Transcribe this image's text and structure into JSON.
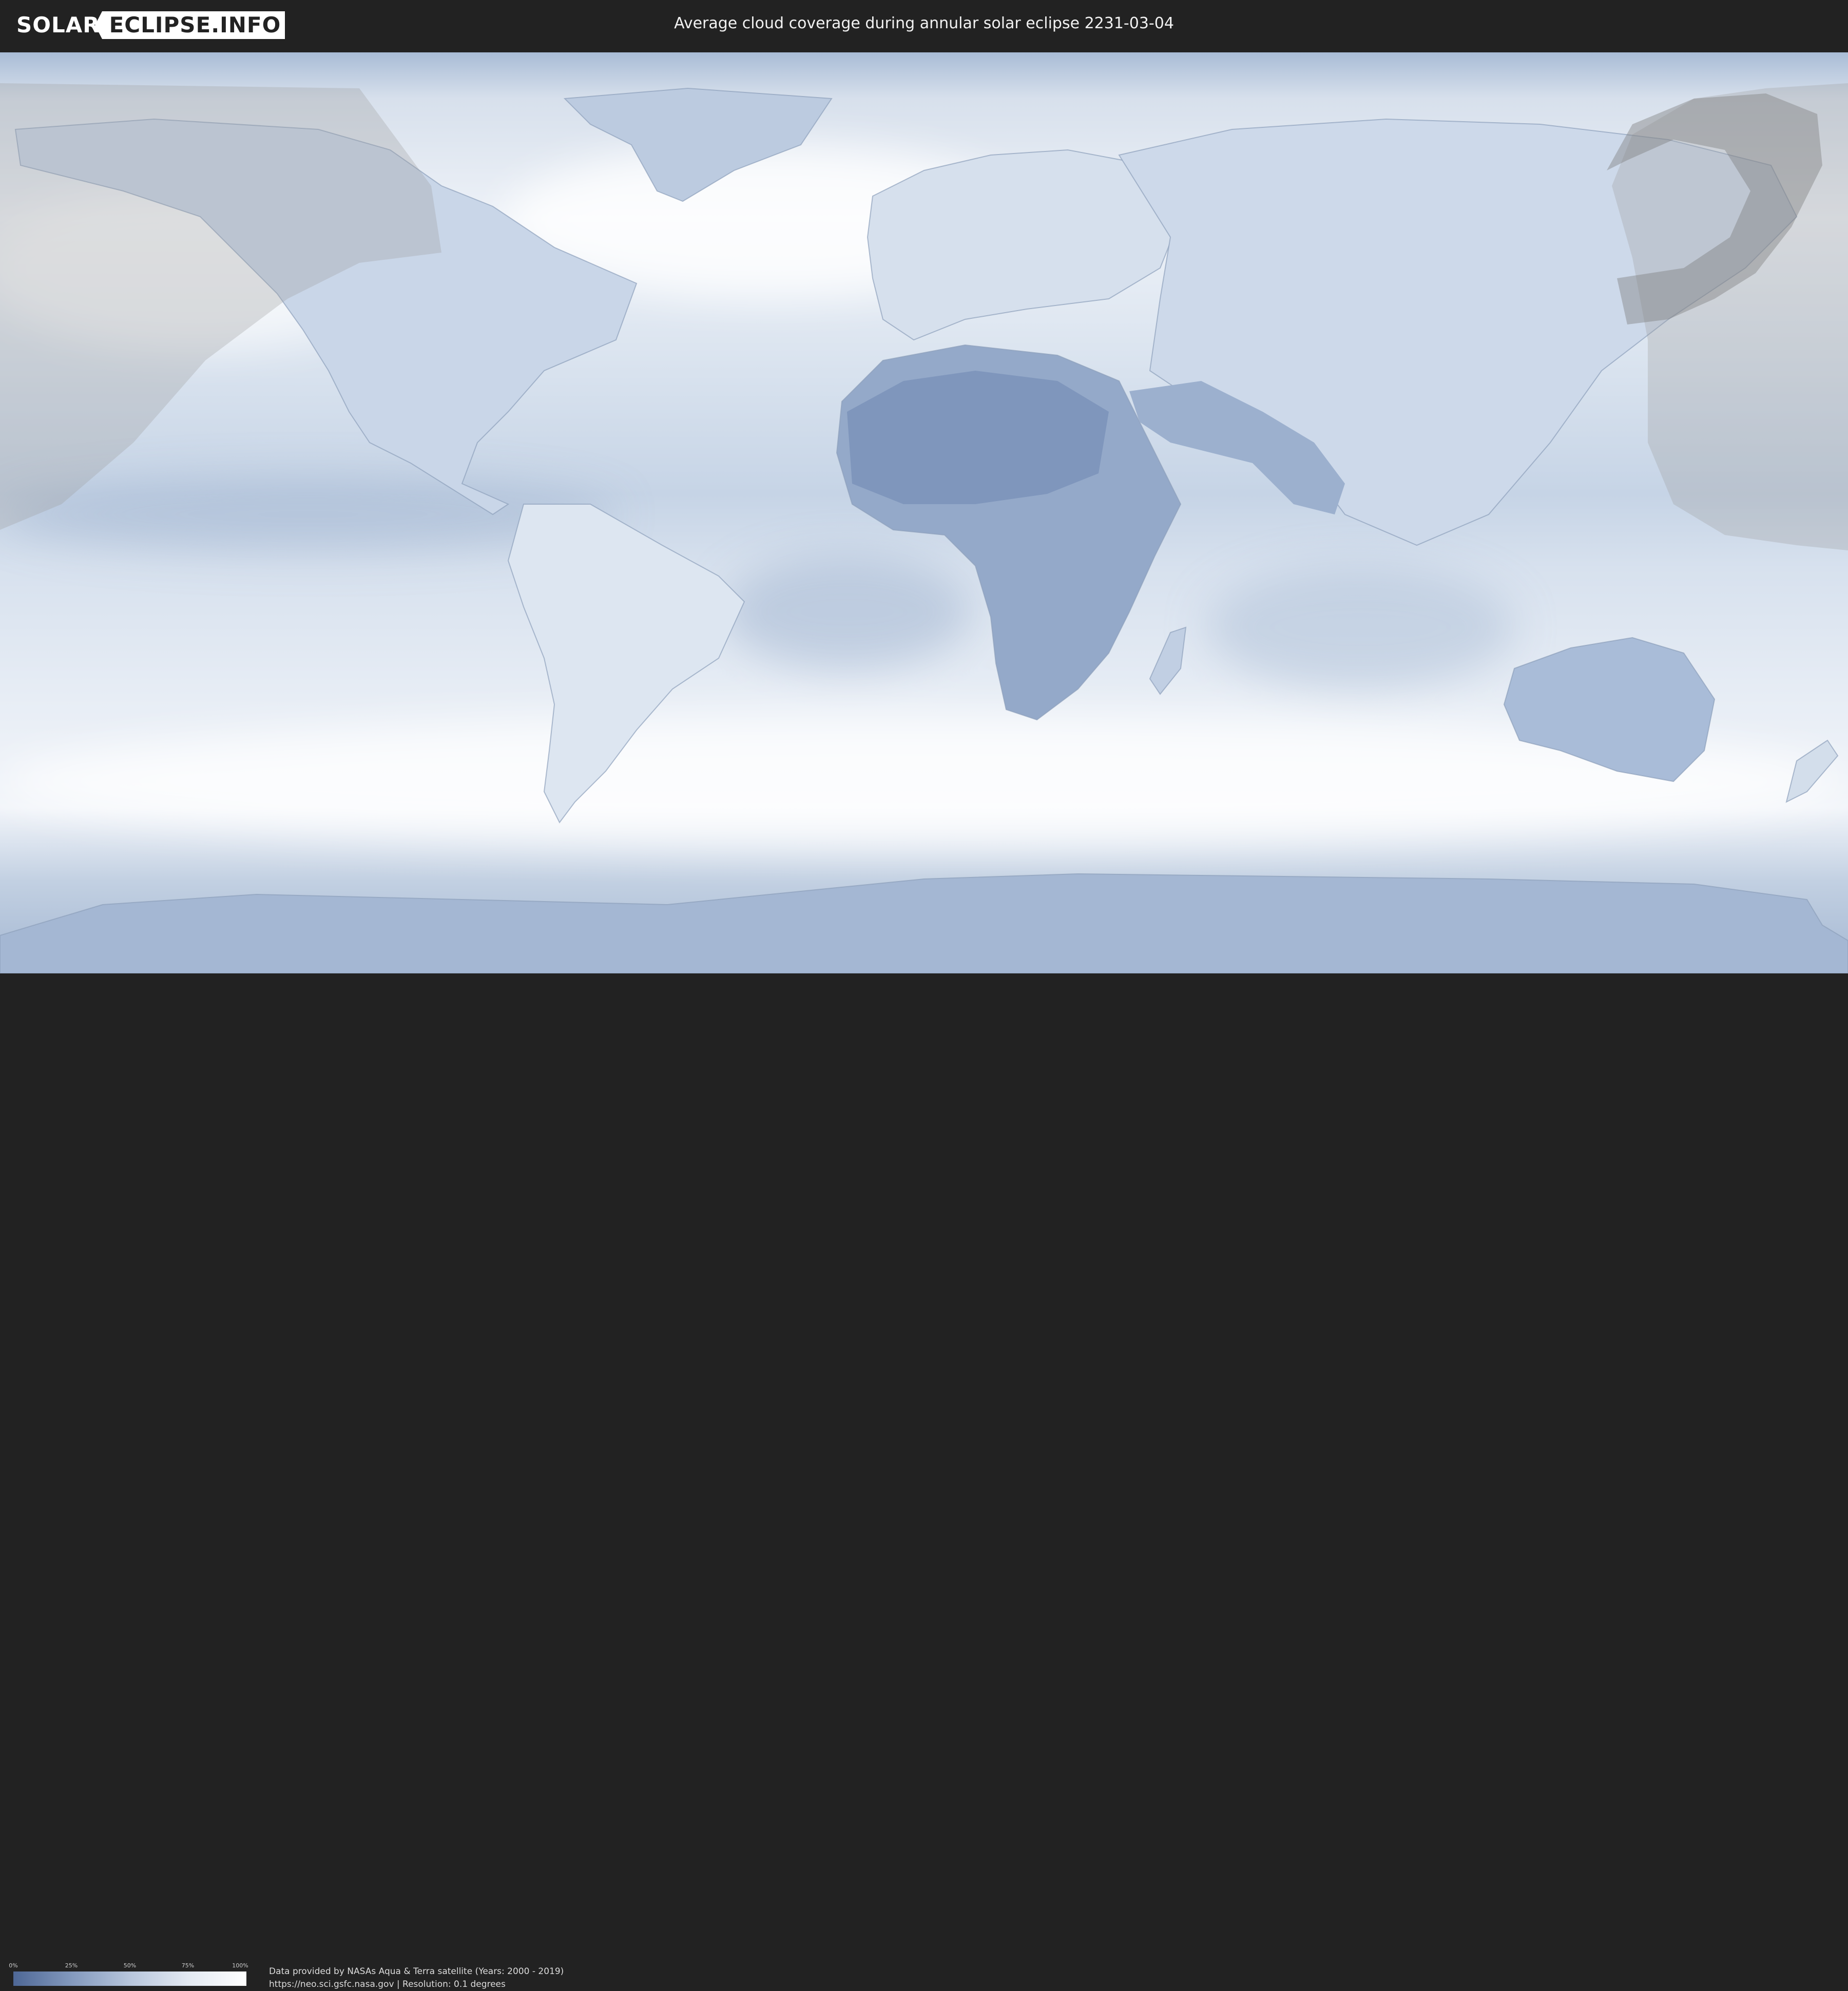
{
  "header": {
    "logo_left": "SOLAR",
    "logo_right": "ECLIPSE.INFO",
    "title": "Average cloud coverage during annular solar eclipse 2231-03-04"
  },
  "legend": {
    "ticks": [
      "0%",
      "25%",
      "50%",
      "75%",
      "100%"
    ],
    "colors": [
      "#4e6796",
      "#8399bd",
      "#b8c6dc",
      "#e3e9f2",
      "#ffffff"
    ]
  },
  "footer": {
    "credit_line1": "Data provided by NASAs Aqua & Terra satellite (Years: 2000 - 2019)",
    "credit_line2": "https://neo.sci.gsfc.nasa.gov | Resolution: 0.1 degrees"
  },
  "colors": {
    "background": "#222222",
    "cloud_low": "#4e6796",
    "cloud_high": "#ffffff",
    "eclipse_shadow": "#9a9a9a"
  }
}
